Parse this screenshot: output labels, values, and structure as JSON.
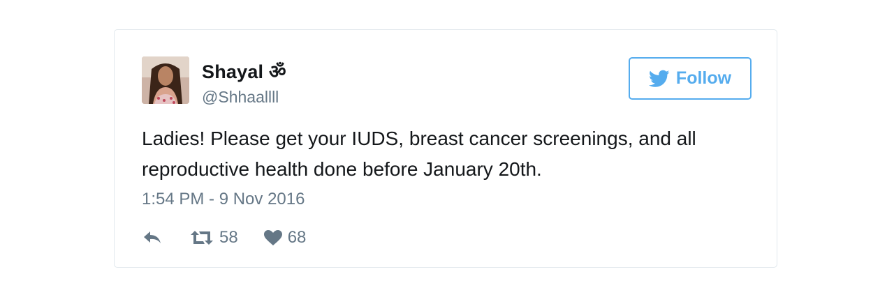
{
  "tweet": {
    "user": {
      "display_name": "Shayal ॐ",
      "handle": "@Shhaallll"
    },
    "follow_button": {
      "label": "Follow",
      "icon": "twitter-bird-icon"
    },
    "text": "Ladies! Please get your IUDS, breast cancer screenings, and all reproductive health done before January 20th.",
    "timestamp": "1:54 PM - 9 Nov 2016",
    "actions": {
      "reply_icon": "reply-icon",
      "retweet_icon": "retweet-icon",
      "retweet_count": "58",
      "like_icon": "heart-icon",
      "like_count": "68"
    }
  },
  "colors": {
    "accent": "#55acee",
    "text": "#14171a",
    "secondary": "#657786",
    "border": "#e1e8ed"
  }
}
